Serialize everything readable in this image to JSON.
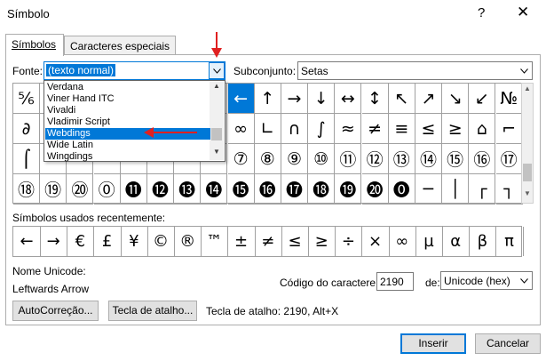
{
  "window": {
    "title": "Símbolo",
    "help_label": "?",
    "close_label": "✕"
  },
  "tabs": [
    {
      "label": "Símbolos",
      "active": true
    },
    {
      "label": "Caracteres especiais",
      "active": false
    }
  ],
  "font": {
    "label": "Fonte:",
    "value": "(texto normal)",
    "options": [
      "Verdana",
      "Viner Hand ITC",
      "Vivaldi",
      "Vladimir Script",
      "Webdings",
      "Wide Latin",
      "Wingdings"
    ],
    "highlighted": "Webdings"
  },
  "subset": {
    "label": "Subconjunto:",
    "value": "Setas"
  },
  "grid": {
    "rows": [
      [
        "⅚",
        "",
        "",
        "",
        "",
        "",
        "",
        "",
        "←",
        "↑",
        "→",
        "↓",
        "↔",
        "↕",
        "↖",
        "↗",
        "↘",
        "↙",
        "№"
      ],
      [
        "∂",
        "",
        "",
        "",
        "",
        "",
        "",
        "",
        "∞",
        "∟",
        "∩",
        "∫",
        "≈",
        "≠",
        "≡",
        "≤",
        "≥",
        "⌂",
        "⌐"
      ],
      [
        "⌠",
        "",
        "",
        "",
        "",
        "",
        "",
        "",
        "⑦",
        "⑧",
        "⑨",
        "⑩",
        "⑪",
        "⑫",
        "⑬",
        "⑭",
        "⑮",
        "⑯",
        "⑰"
      ],
      [
        "⑱",
        "⑲",
        "⑳",
        "⓪",
        "⓫",
        "⓬",
        "⓭",
        "⓮",
        "⓯",
        "⓰",
        "⓱",
        "⓲",
        "⓳",
        "⓴",
        "⓿",
        "─",
        "│",
        "┌",
        "┐"
      ]
    ],
    "selected": "←"
  },
  "recent": {
    "label": "Símbolos usados recentemente:",
    "symbols": [
      "←",
      "→",
      "€",
      "£",
      "¥",
      "©",
      "®",
      "™",
      "±",
      "≠",
      "≤",
      "≥",
      "÷",
      "×",
      "∞",
      "µ",
      "α",
      "β",
      "π"
    ]
  },
  "unicode": {
    "name_label": "Nome Unicode:",
    "name_value": "Leftwards Arrow"
  },
  "char_code": {
    "label": "Código do caractere:",
    "value": "2190",
    "from_label": "de:",
    "from_value": "Unicode (hex)"
  },
  "buttons": {
    "autocorrect": "AutoCorreção...",
    "shortcut_key": "Tecla de atalho...",
    "insert": "Inserir",
    "cancel": "Cancelar"
  },
  "shortcut_text": "Tecla de atalho: 2190, Alt+X",
  "colors": {
    "accent": "#0078d7",
    "annotation": "#e02020"
  }
}
